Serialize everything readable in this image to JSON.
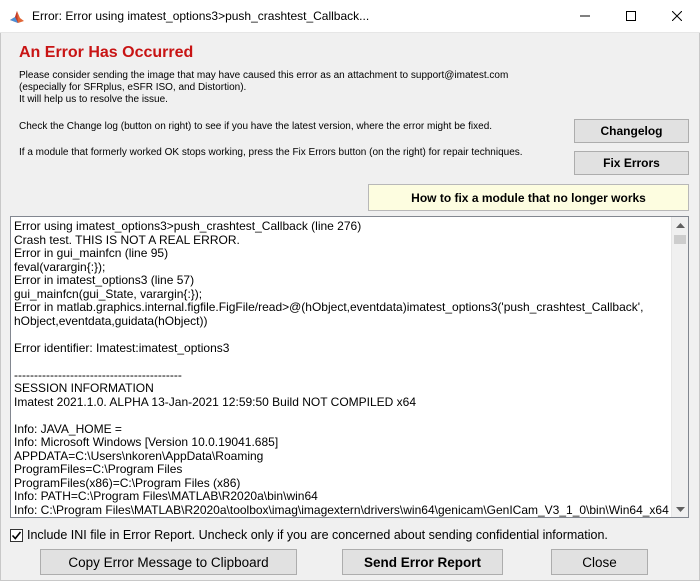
{
  "window": {
    "title": "Error: Error using imatest_options3>push_crashtest_Callback...",
    "icon": "matlab-icon"
  },
  "header": {
    "heading": "An Error Has Occurred",
    "info_lines": [
      "Please consider sending the image that may have caused this error as an attachment to support@imatest.com",
      "(especially for SFRplus, eSFR ISO, and Distortion).",
      "It will help us to resolve the issue."
    ],
    "changelog_hint": "Check the Change log (button on right) to see if you have the latest version, where the error might be fixed.",
    "fix_hint": "If a module that formerly worked OK stops working, press the Fix Errors button (on the right) for repair techniques."
  },
  "buttons": {
    "changelog": "Changelog",
    "fix_errors": "Fix Errors",
    "how_to_fix": "How to fix a module that no longer works",
    "copy": "Copy Error Message to Clipboard",
    "send": "Send Error Report",
    "close": "Close"
  },
  "log": {
    "lines": [
      "Error using imatest_options3>push_crashtest_Callback (line 276)",
      "Crash test. THIS IS NOT A REAL ERROR.",
      "Error in gui_mainfcn (line 95)",
      "        feval(varargin{:});",
      "Error in imatest_options3 (line 57)",
      "        gui_mainfcn(gui_State, varargin{:});",
      "Error in matlab.graphics.internal.figfile.FigFile/read>@(hObject,eventdata)imatest_options3('push_crashtest_Callback',",
      "hObject,eventdata,guidata(hObject))",
      "",
      "Error identifier: Imatest:imatest_options3",
      "",
      "------------------------------------------",
      "SESSION INFORMATION",
      "Imatest  2021.1.0. ALPHA 13-Jan-2021 12:59:50   Build NOT COMPILED x64",
      "",
      "Info: JAVA_HOME =",
      "Info: Microsoft Windows [Version 10.0.19041.685]",
      "APPDATA=C:\\Users\\nkoren\\AppData\\Roaming",
      "ProgramFiles=C:\\Program Files",
      "ProgramFiles(x86)=C:\\Program Files (x86)",
      "Info: PATH=C:\\Program Files\\MATLAB\\R2020a\\bin\\win64",
      "Info: C:\\Program Files\\MATLAB\\R2020a\\toolbox\\imag\\imagextern\\drivers\\win64\\genicam\\GenICam_V3_1_0\\bin\\Win64_x64"
    ]
  },
  "footer": {
    "include_ini_label": "Include INI file in Error Report. Uncheck only if you are concerned about sending confidential information.",
    "include_ini_checked": true
  }
}
